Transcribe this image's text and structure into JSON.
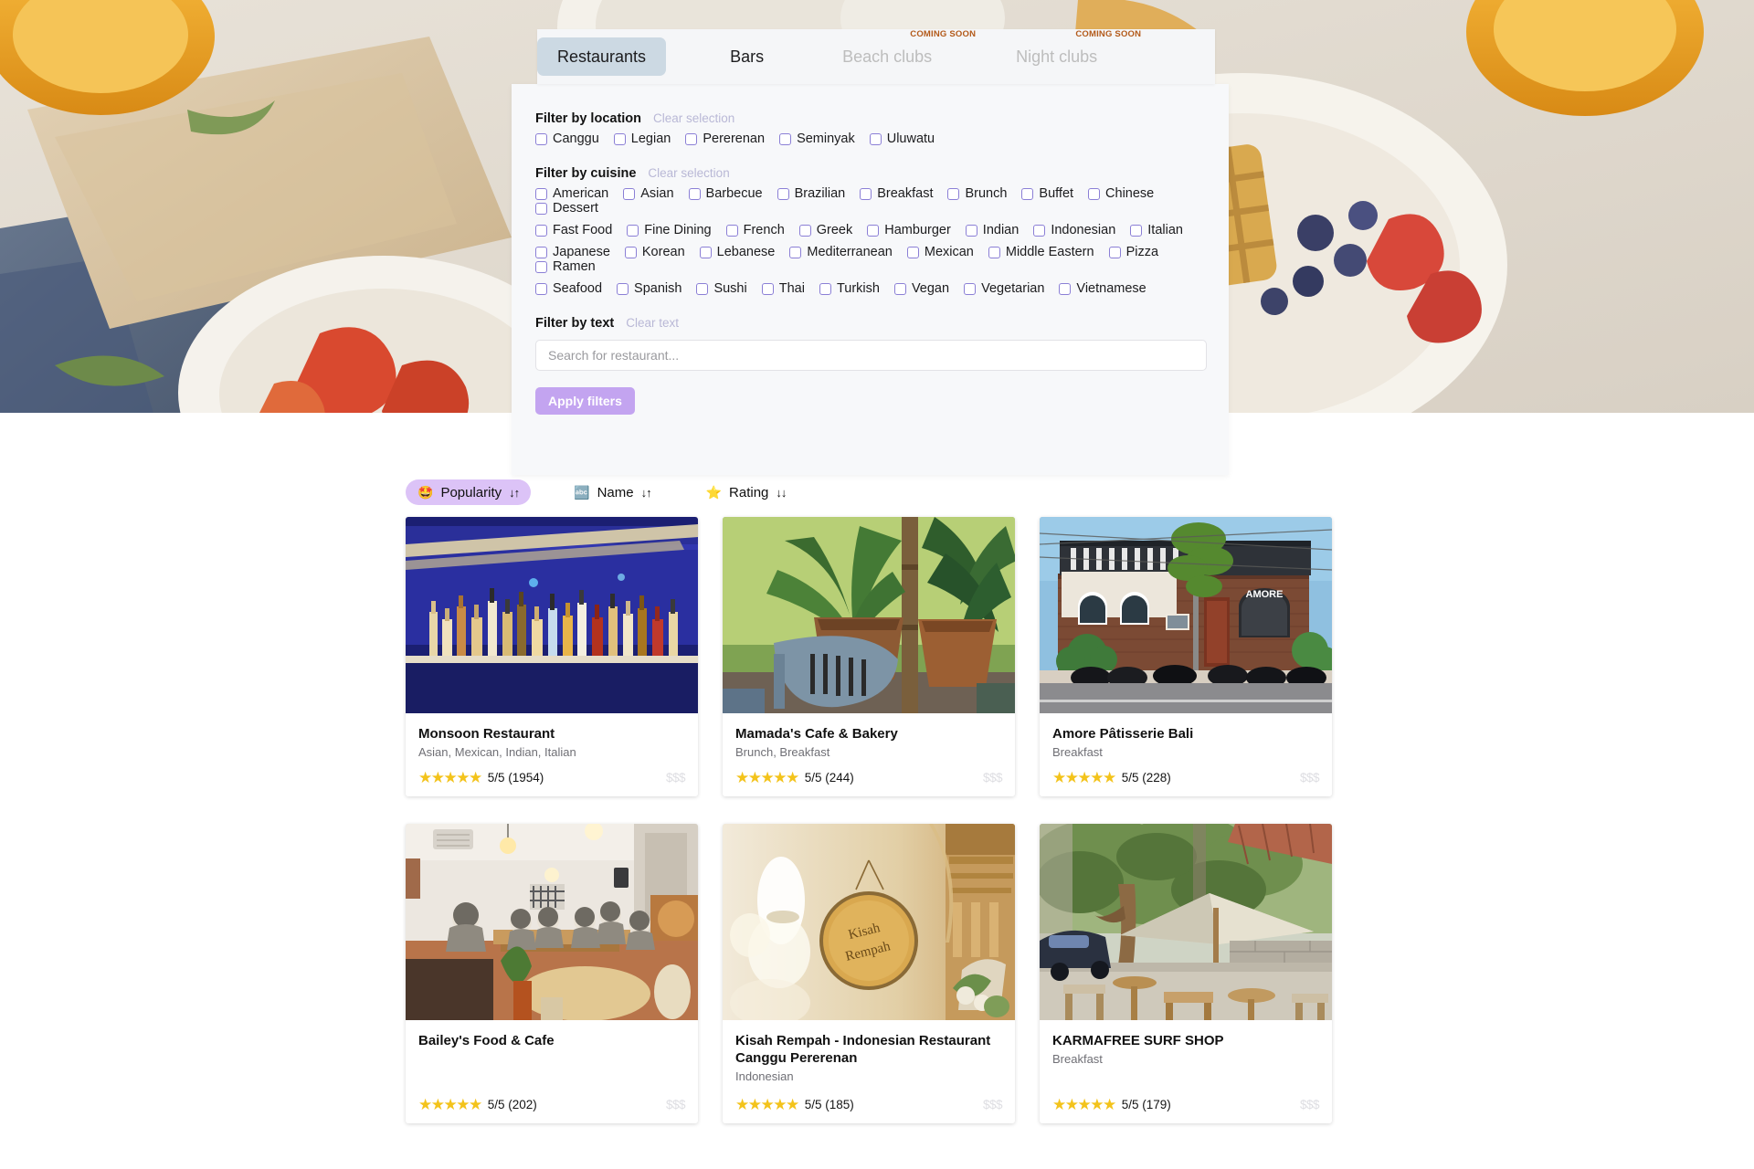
{
  "colors": {
    "accent_purple": "#c3a4f0",
    "sort_active_bg": "#dcc3f7",
    "tab_active_bg": "#ccd9e3",
    "coming_soon": "#b35a1a",
    "star_yellow": "#f3c31b",
    "panel_bg": "#f7f8fa",
    "price_grey": "#dedee2"
  },
  "tabs": [
    {
      "label": "Restaurants",
      "state": "active",
      "badge": ""
    },
    {
      "label": "Bars",
      "state": "enabled",
      "badge": ""
    },
    {
      "label": "Beach clubs",
      "state": "disabled",
      "badge": "COMING SOON"
    },
    {
      "label": "Night clubs",
      "state": "disabled",
      "badge": "COMING SOON"
    }
  ],
  "filters": {
    "location": {
      "title": "Filter by location",
      "clear_label": "Clear selection",
      "options": [
        "Canggu",
        "Legian",
        "Pererenan",
        "Seminyak",
        "Uluwatu"
      ]
    },
    "cuisine": {
      "title": "Filter by cuisine",
      "clear_label": "Clear selection",
      "rows": [
        [
          "American",
          "Asian",
          "Barbecue",
          "Brazilian",
          "Breakfast",
          "Brunch",
          "Buffet",
          "Chinese",
          "Dessert"
        ],
        [
          "Fast Food",
          "Fine Dining",
          "French",
          "Greek",
          "Hamburger",
          "Indian",
          "Indonesian",
          "Italian"
        ],
        [
          "Japanese",
          "Korean",
          "Lebanese",
          "Mediterranean",
          "Mexican",
          "Middle Eastern",
          "Pizza",
          "Ramen"
        ],
        [
          "Seafood",
          "Spanish",
          "Sushi",
          "Thai",
          "Turkish",
          "Vegan",
          "Vegetarian",
          "Vietnamese"
        ]
      ]
    },
    "text": {
      "title": "Filter by text",
      "clear_label": "Clear text",
      "value": "",
      "placeholder": "Search for restaurant..."
    },
    "apply_label": "Apply filters"
  },
  "sort": {
    "options": [
      {
        "label": "Popularity",
        "icon": "star-struck-emoji",
        "glyph": "🤩",
        "arrows": "↓↑",
        "active": true
      },
      {
        "label": "Name",
        "icon": "input-latin-letters-emoji",
        "glyph": "🔤",
        "arrows": "↓↑",
        "active": false
      },
      {
        "label": "Rating",
        "icon": "star-emoji",
        "glyph": "⭐",
        "arrows": "↓↓",
        "active": false
      }
    ]
  },
  "cards": [
    {
      "name": "Monsoon Restaurant",
      "cuisine": "Asian, Mexican, Indian, Italian",
      "stars": "★★★★★",
      "rating": "5/5 (1954)",
      "price": "$$$",
      "image": "bar-bottles-blue-light"
    },
    {
      "name": "Mamada's Cafe & Bakery",
      "cuisine": "Brunch, Breakfast",
      "stars": "★★★★★",
      "rating": "5/5 (244)",
      "price": "$$$",
      "image": "garden-terrace-palm-chair"
    },
    {
      "name": "Amore Pâtisserie Bali",
      "cuisine": "Breakfast",
      "stars": "★★★★★",
      "rating": "5/5 (228)",
      "price": "$$$",
      "image": "street-facade-scooters-amore"
    },
    {
      "name": "Bailey's Food & Cafe",
      "cuisine": "",
      "stars": "★★★★★",
      "rating": "5/5 (202)",
      "price": "$$$",
      "image": "cafe-interior-people-dining"
    },
    {
      "name": "Kisah Rempah - Indonesian Restaurant Canggu Pererenan",
      "cuisine": "Indonesian",
      "stars": "★★★★★",
      "rating": "5/5 (185)",
      "price": "$$$",
      "image": "wall-hanging-round-sign"
    },
    {
      "name": "KARMAFREE SURF SHOP",
      "cuisine": "Breakfast",
      "stars": "★★★★★",
      "rating": "5/5 (179)",
      "price": "$$$",
      "image": "outdoor-patio-umbrella-trees"
    }
  ]
}
